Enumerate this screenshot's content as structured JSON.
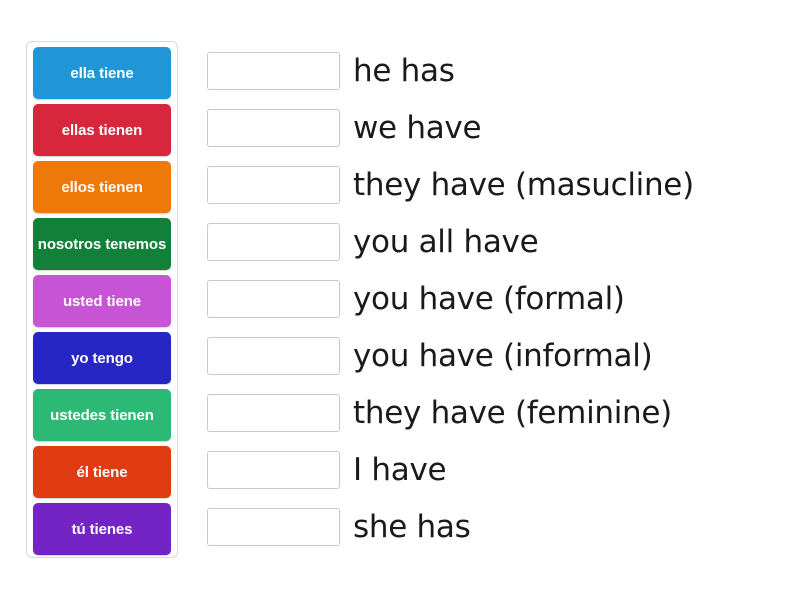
{
  "activity": {
    "type": "match-up",
    "subject": "Spanish verb tener conjugations"
  },
  "colors": {
    "panel_border": "#d9d9d9",
    "dropzone_border": "#c9c9c9",
    "label_text": "#1a1a1a",
    "background": "#ffffff"
  },
  "tiles": [
    {
      "label": "ella tiene",
      "color": "#2196d6"
    },
    {
      "label": "ellas tienen",
      "color": "#d8273c"
    },
    {
      "label": "ellos tienen",
      "color": "#ed7909"
    },
    {
      "label": "nosotros tenemos",
      "color": "#13803a"
    },
    {
      "label": "usted tiene",
      "color": "#c654d4"
    },
    {
      "label": "yo tengo",
      "color": "#2626c4"
    },
    {
      "label": "ustedes tienen",
      "color": "#2cb976"
    },
    {
      "label": "él tiene",
      "color": "#e03b13"
    },
    {
      "label": "tú tienes",
      "color": "#7423c4"
    }
  ],
  "rows": [
    {
      "answer": "",
      "label": "he has"
    },
    {
      "answer": "",
      "label": "we have"
    },
    {
      "answer": "",
      "label": "they have (masucline)"
    },
    {
      "answer": "",
      "label": "you all have"
    },
    {
      "answer": "",
      "label": "you have (formal)"
    },
    {
      "answer": "",
      "label": "you have (informal)"
    },
    {
      "answer": "",
      "label": "they have (feminine)"
    },
    {
      "answer": "",
      "label": "I have"
    },
    {
      "answer": "",
      "label": "she has"
    }
  ]
}
